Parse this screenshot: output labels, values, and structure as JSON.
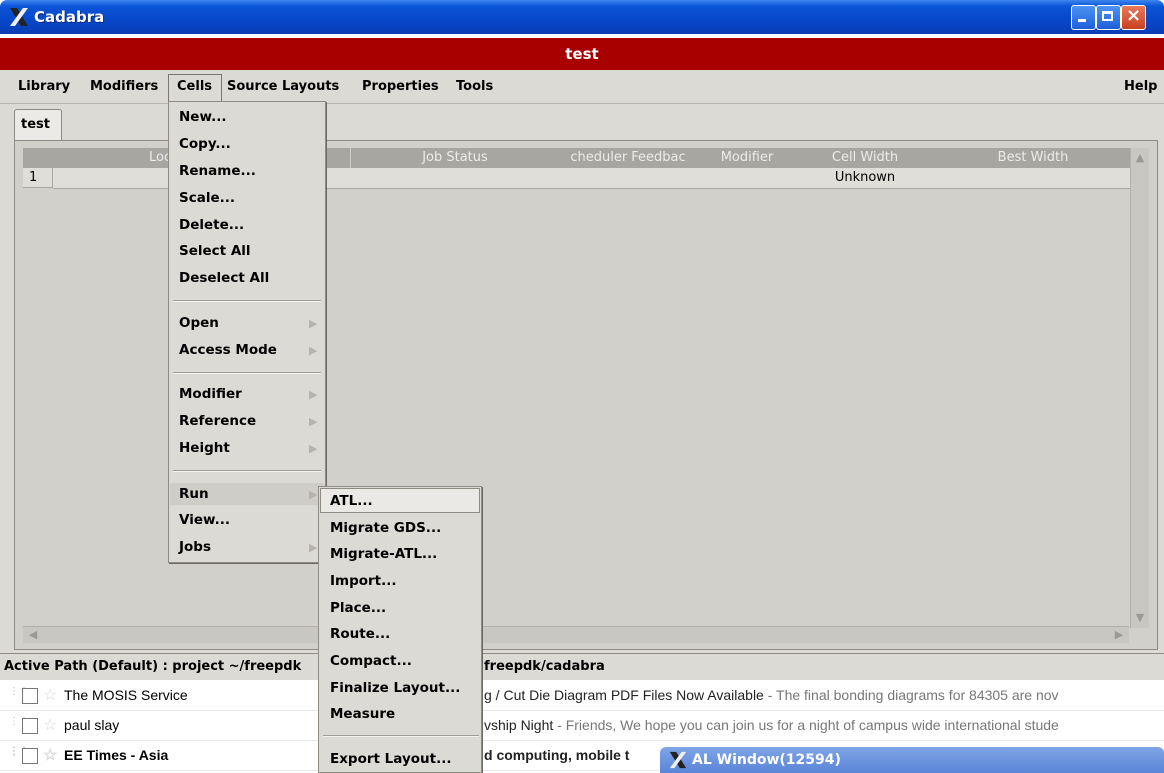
{
  "window": {
    "title": "Cadabra",
    "minimize_icon": "minimize-icon",
    "maximize_icon": "maximize-icon",
    "close_icon": "close-icon"
  },
  "header": {
    "title": "test"
  },
  "menubar": {
    "library": "Library",
    "modifiers": "Modifiers",
    "cells": "Cells",
    "source_layouts": "Source Layouts",
    "properties": "Properties",
    "tools": "Tools",
    "help": "Help"
  },
  "tab": {
    "label": "test"
  },
  "table": {
    "columns": [
      "Lock",
      "Job Status",
      "cheduler Feedbac",
      "Modifier",
      "Cell Width",
      "Best Width"
    ],
    "rows": [
      {
        "index": "1",
        "cell_width": "Unknown"
      }
    ]
  },
  "status": {
    "path_left": "Active Path (Default) : project ~/freepdk",
    "path_right": "freepdk/cadabra"
  },
  "cells_menu": {
    "new": "New...",
    "copy": "Copy...",
    "rename": "Rename...",
    "scale": "Scale...",
    "delete": "Delete...",
    "select_all": "Select All",
    "deselect_all": "Deselect All",
    "open": "Open",
    "access_mode": "Access Mode",
    "modifier": "Modifier",
    "reference": "Reference",
    "height": "Height",
    "run": "Run",
    "view": "View...",
    "jobs": "Jobs"
  },
  "run_menu": {
    "atl": "ATL...",
    "migrate_gds": "Migrate GDS...",
    "migrate_atl": "Migrate-ATL...",
    "import": "Import...",
    "place": "Place...",
    "route": "Route...",
    "compact": "Compact...",
    "finalize_layout": "Finalize Layout...",
    "measure": "Measure",
    "export_layout": "Export Layout..."
  },
  "mail": [
    {
      "sender": "The MOSIS Service",
      "subject": "g / Cut Die Diagram PDF Files Now Available",
      "snippet": " - The final bonding diagrams for 84305 are nov"
    },
    {
      "sender": "paul slay",
      "subject": "vship Night",
      "snippet": " - Friends, We hope you can join us for a night of campus wide international stude"
    },
    {
      "sender": "EE Times - Asia",
      "subject": "d computing, mobile t",
      "snippet": ""
    }
  ],
  "taskbar": {
    "al_window": "AL Window(12594)"
  }
}
